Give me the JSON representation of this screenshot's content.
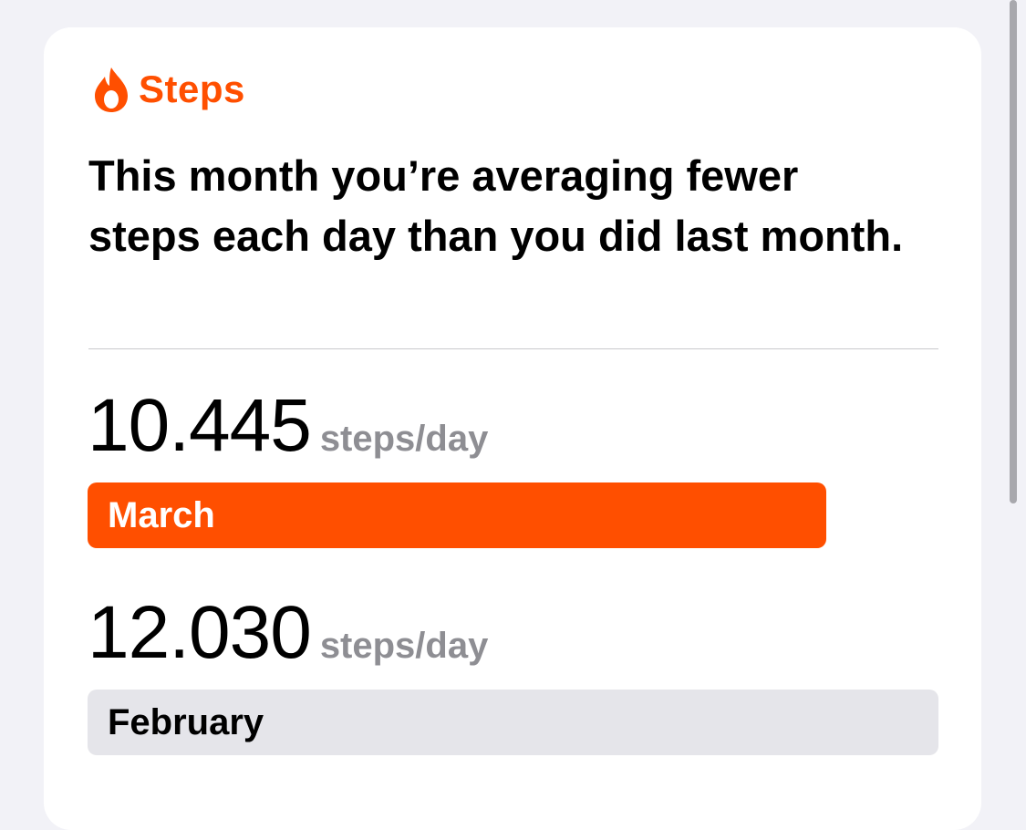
{
  "header": {
    "icon": "flame-icon",
    "title": "Steps",
    "accent_color": "#ff4f00"
  },
  "summary": "This month you’re averaging fewer steps each day than you did last month.",
  "current": {
    "value": "10.445",
    "unit": "steps/day",
    "label": "March",
    "bar_color": "#ff4f00",
    "label_color": "#ffffff",
    "bar_fraction": 0.868
  },
  "previous": {
    "value": "12.030",
    "unit": "steps/day",
    "label": "February",
    "bar_color": "#e5e5ea",
    "label_color": "#000000",
    "bar_fraction": 1.0
  }
}
